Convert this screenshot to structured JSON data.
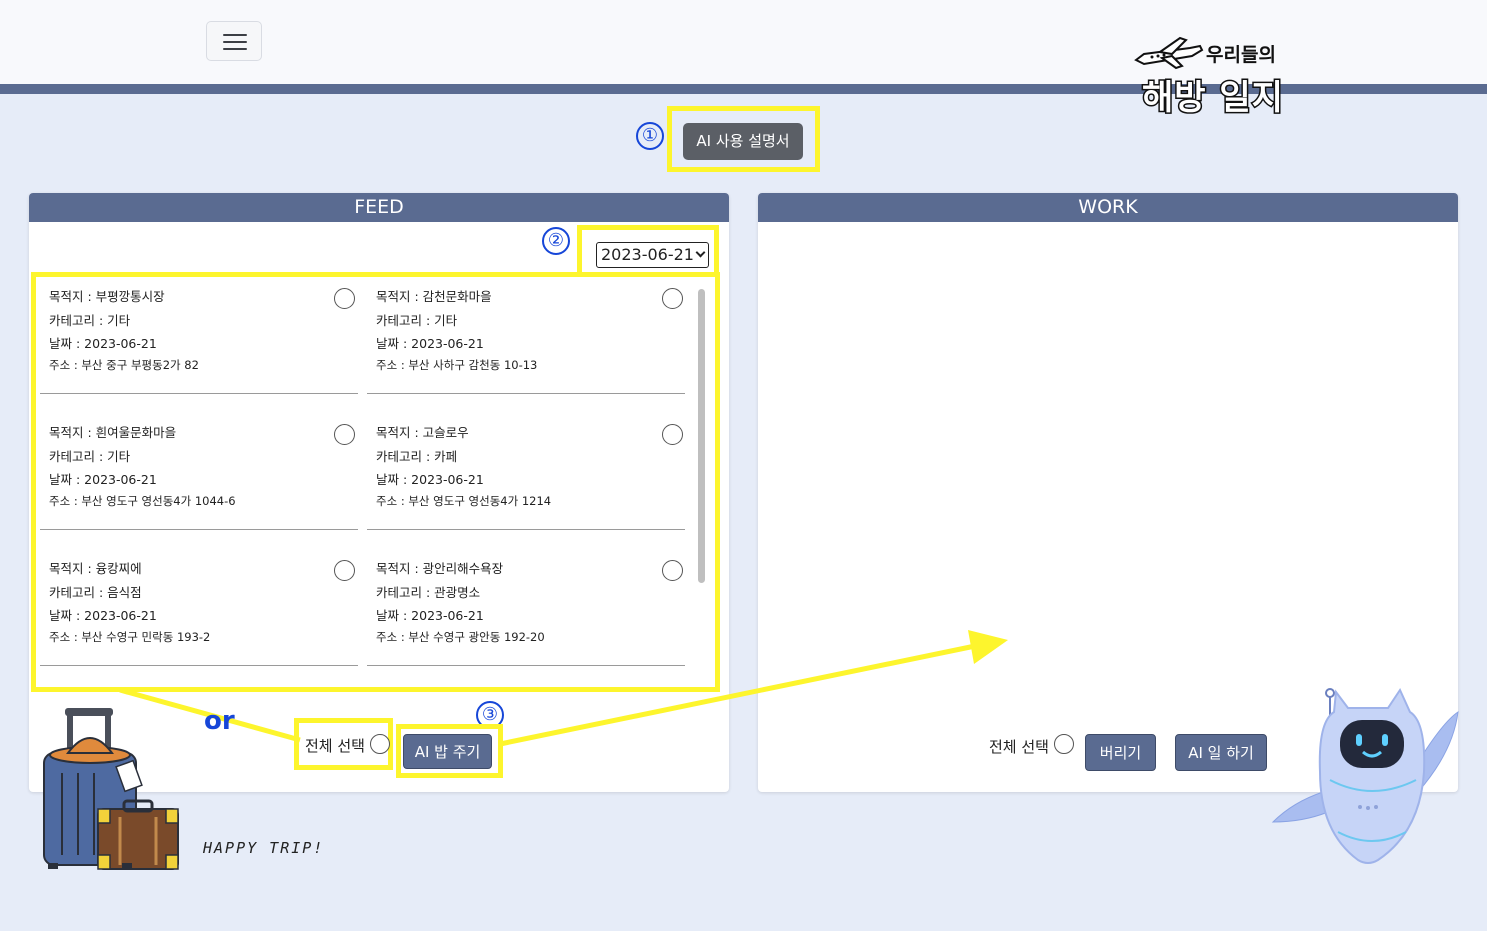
{
  "header": {
    "logo_top": "우리들의",
    "logo_main": "해방 일지"
  },
  "annotations": {
    "step1": "①",
    "step2": "②",
    "step3": "③",
    "or": "or"
  },
  "guide_button": "AI 사용 설명서",
  "feed": {
    "title": "FEED",
    "date_selected": "2023-06-21",
    "items": [
      {
        "dest": "목적지 : 부평깡통시장",
        "category": "카테고리 : 기타",
        "date": "날짜 : 2023-06-21",
        "address": "주소 : 부산 중구 부평동2가 82"
      },
      {
        "dest": "목적지 : 감천문화마을",
        "category": "카테고리 : 기타",
        "date": "날짜 : 2023-06-21",
        "address": "주소 : 부산 사하구 감천동 10-13"
      },
      {
        "dest": "목적지 : 흰여울문화마을",
        "category": "카테고리 : 기타",
        "date": "날짜 : 2023-06-21",
        "address": "주소 : 부산 영도구 영선동4가 1044-6"
      },
      {
        "dest": "목적지 : 고슬로우",
        "category": "카테고리 : 카페",
        "date": "날짜 : 2023-06-21",
        "address": "주소 : 부산 영도구 영선동4가 1214"
      },
      {
        "dest": "목적지 : 융캉찌에",
        "category": "카테고리 : 음식점",
        "date": "날짜 : 2023-06-21",
        "address": "주소 : 부산 수영구 민락동 193-2"
      },
      {
        "dest": "목적지 : 광안리해수욕장",
        "category": "카테고리 : 관광명소",
        "date": "날짜 : 2023-06-21",
        "address": "주소 : 부산 수영구 광안동 192-20"
      }
    ],
    "select_all_label": "전체 선택",
    "feed_button": "AI 밥 주기"
  },
  "work": {
    "title": "WORK",
    "select_all_label": "전체 선택",
    "discard_button": "버리기",
    "work_button": "AI 일 하기"
  },
  "footer": {
    "happy_trip": "HAPPY TRIP!"
  },
  "colors": {
    "navy": "#5a6b91",
    "highlight": "#fdf52d",
    "annotation_blue": "#1646d8",
    "background": "#e6ecf8"
  }
}
